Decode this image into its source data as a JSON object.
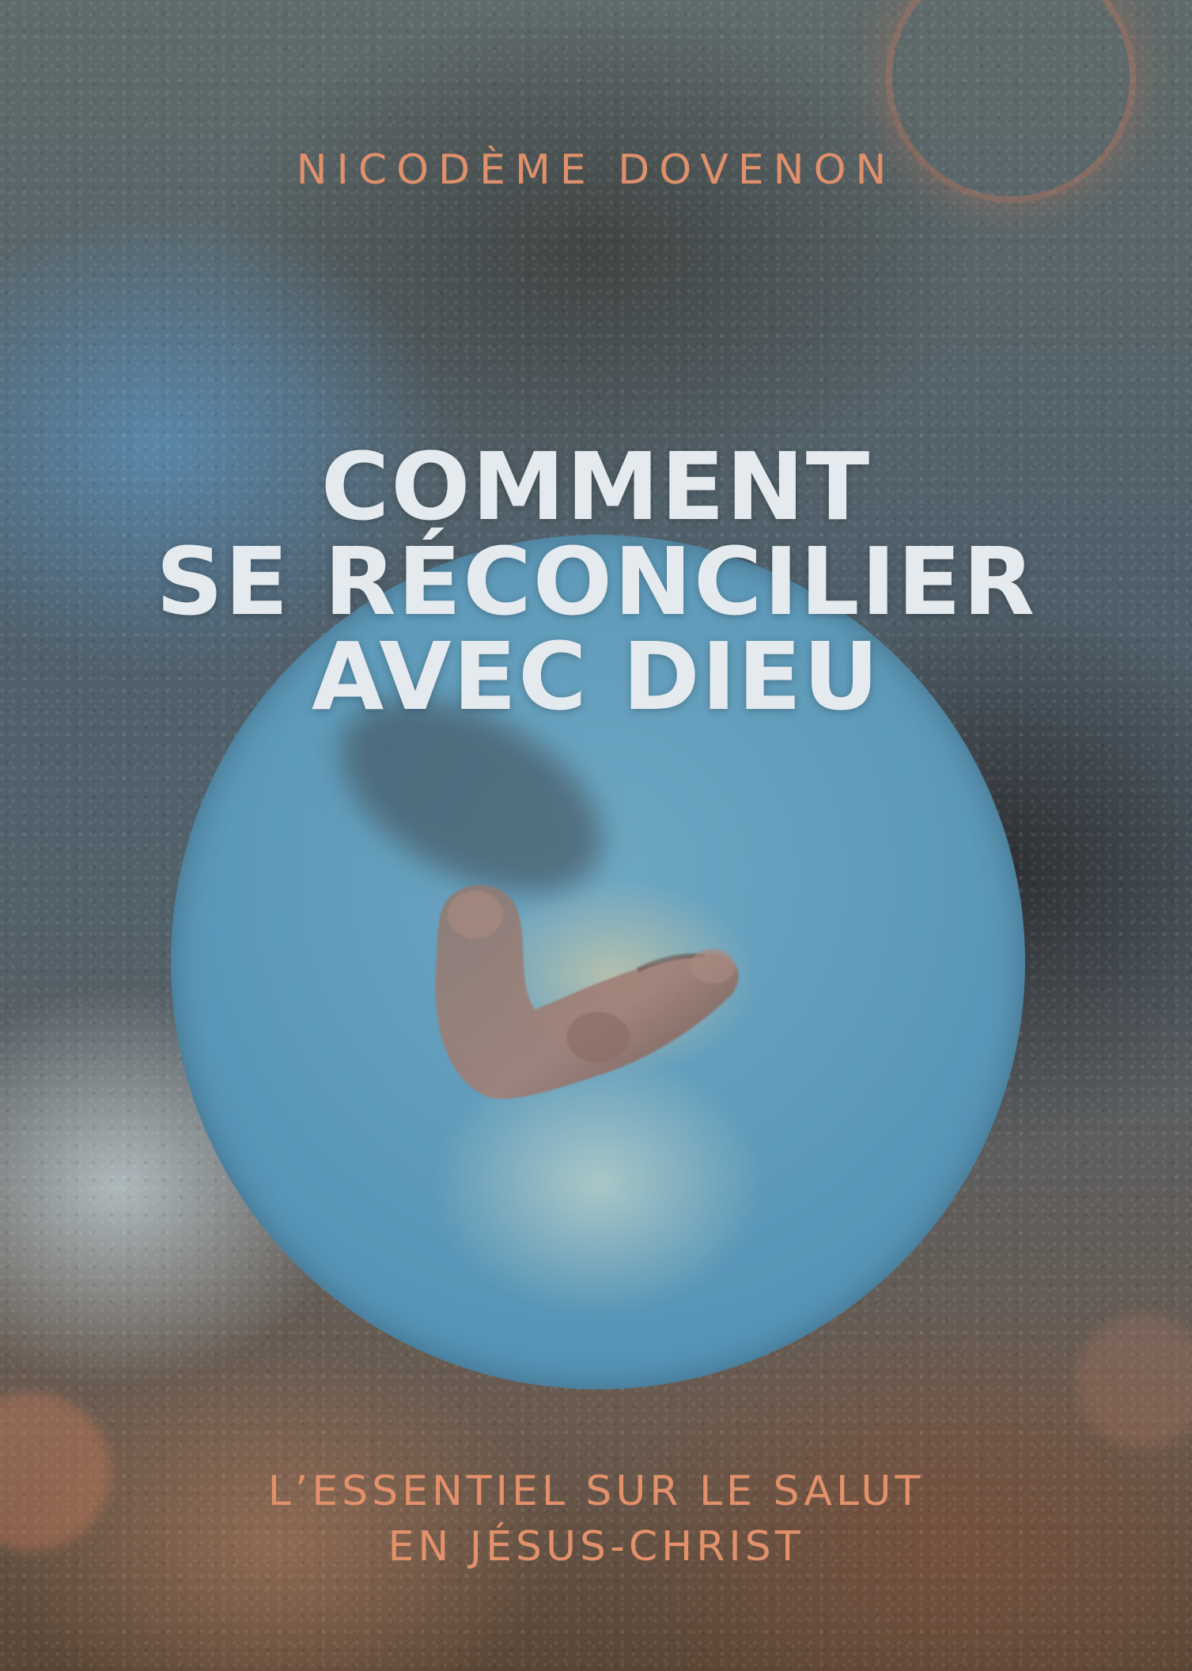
{
  "cover": {
    "author": "NICODÈME DOVENON",
    "title_lines": [
      "COMMENT",
      "SE RÉCONCILIER",
      "AVEC DIEU"
    ],
    "subtitle_lines": [
      "L’ESSENTIEL SUR LE SALUT",
      "EN JÉSUS-CHRIST"
    ]
  },
  "colors": {
    "accent": "#e0906b",
    "title": "#e4eaee",
    "circle": "#5c98b8"
  }
}
